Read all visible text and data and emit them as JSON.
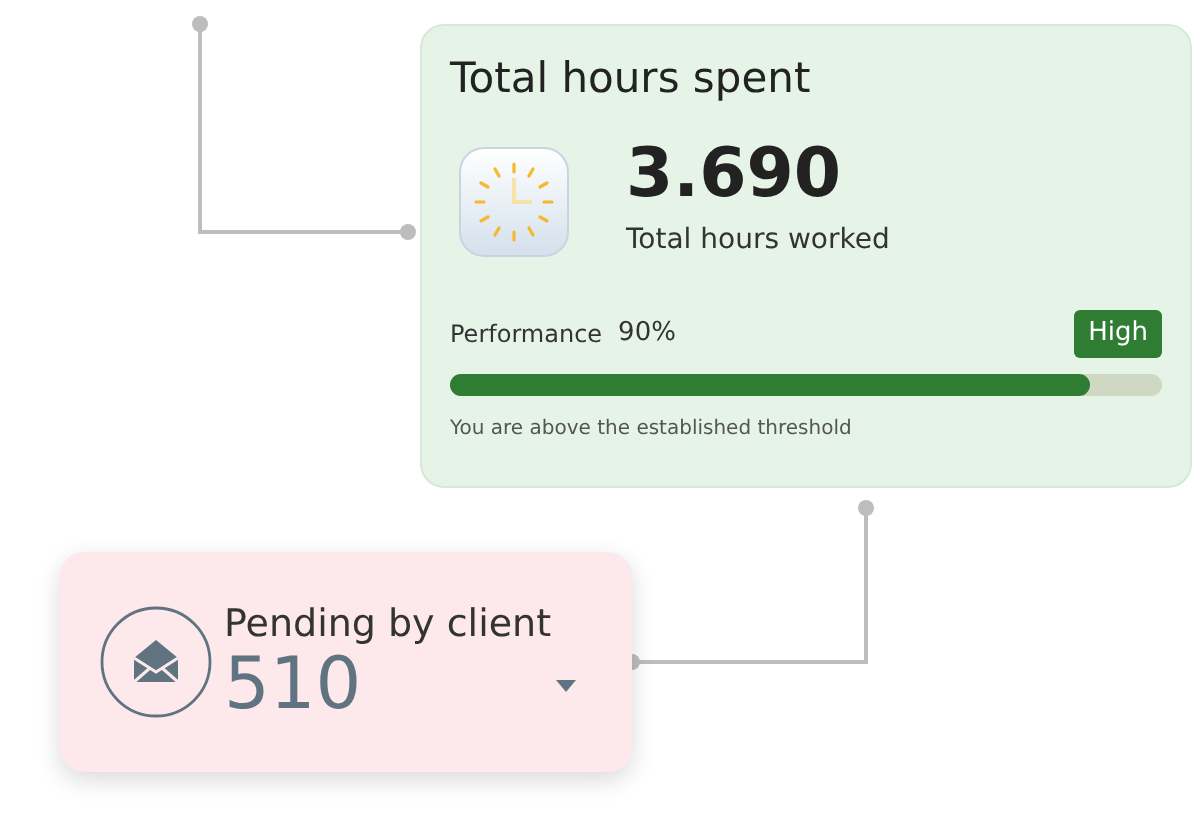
{
  "total_card": {
    "title": "Total hours spent",
    "value": "3.690",
    "value_label": "Total hours worked",
    "performance": {
      "label": "Performance",
      "percent": "90%",
      "badge": "High",
      "level": 0.9
    },
    "note": "You are above the established threshold"
  },
  "pending_card": {
    "title": "Pending by client",
    "value": "510"
  }
}
